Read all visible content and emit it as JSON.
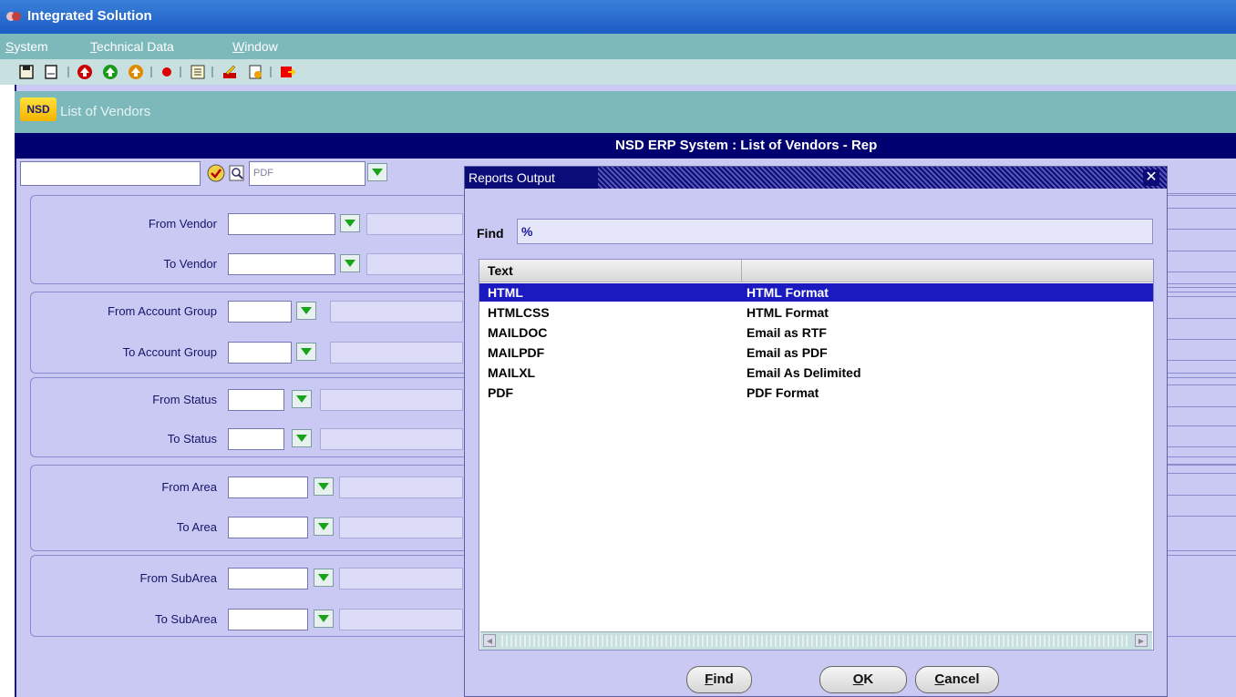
{
  "window": {
    "title": "Integrated Solution"
  },
  "menu": {
    "items": [
      {
        "accel": "S",
        "rest": "ystem"
      },
      {
        "accel": "T",
        "rest": "echnical Data"
      },
      {
        "accel": "W",
        "rest": "indow"
      }
    ]
  },
  "toolbar": {
    "icons": [
      "save-icon",
      "new-icon",
      "up-arrow-icon",
      "up-arrow-green-icon",
      "up-arrow-orange-icon",
      "record-icon",
      "list-icon",
      "edit-icon",
      "open-icon",
      "exit-icon"
    ]
  },
  "form": {
    "logo": "NSD",
    "title": "List of Vendors",
    "banner": "NSD ERP System : List of Vendors - Rep",
    "format_value": "PDF",
    "fields": [
      {
        "label": "From Vendor"
      },
      {
        "label": "To Vendor"
      },
      {
        "label": "From Account Group"
      },
      {
        "label": "To Account Group"
      },
      {
        "label": "From Status"
      },
      {
        "label": "To  Status"
      },
      {
        "label": "From Area"
      },
      {
        "label": "To Area"
      },
      {
        "label": "From SubArea"
      },
      {
        "label": "To SubArea"
      }
    ]
  },
  "dialog": {
    "title": "Reports Output",
    "close_label": "✕",
    "find_label": "Find",
    "find_value": "%",
    "column_header": "Text",
    "rows": [
      {
        "code": "HTML",
        "description": "HTML Format",
        "selected": true
      },
      {
        "code": "HTMLCSS",
        "description": "HTML Format",
        "selected": false
      },
      {
        "code": "MAILDOC",
        "description": "Email as RTF",
        "selected": false
      },
      {
        "code": "MAILPDF",
        "description": "Email as PDF",
        "selected": false
      },
      {
        "code": "MAILXL",
        "description": "Email As Delimited",
        "selected": false
      },
      {
        "code": "PDF",
        "description": "PDF Format",
        "selected": false
      }
    ],
    "buttons": {
      "find": {
        "accel": "F",
        "rest": "ind"
      },
      "ok": {
        "accel": "O",
        "rest": "K"
      },
      "cancel": {
        "accel": "C",
        "rest": "ancel"
      }
    }
  },
  "colors": {
    "banner": "#000070",
    "form_bg": "#c9c9f3",
    "teal": "#7db9bb",
    "selection": "#1a1ac0"
  }
}
